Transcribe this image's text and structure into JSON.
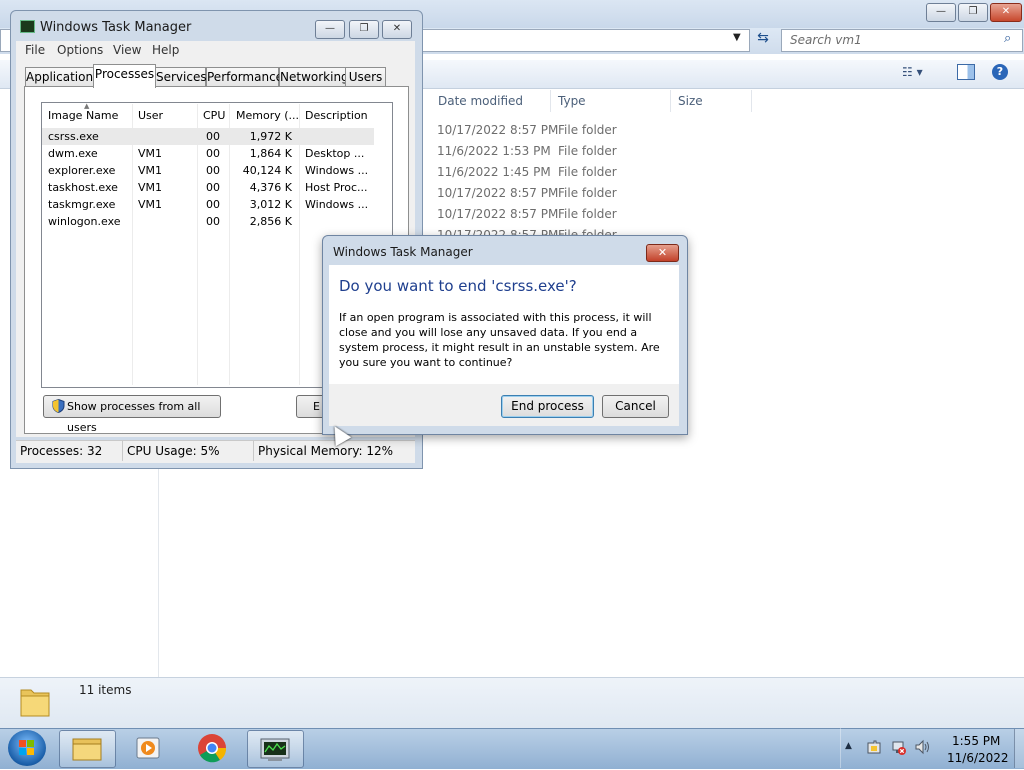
{
  "explorer": {
    "search_placeholder": "Search vm1",
    "columns": [
      "Date modified",
      "Type",
      "Size"
    ],
    "rows": [
      {
        "date": "10/17/2022 8:57 PM",
        "type": "File folder"
      },
      {
        "date": "11/6/2022 1:53 PM",
        "type": "File folder"
      },
      {
        "date": "11/6/2022 1:45 PM",
        "type": "File folder"
      },
      {
        "date": "10/17/2022 8:57 PM",
        "type": "File folder"
      },
      {
        "date": "10/17/2022 8:57 PM",
        "type": "File folder"
      },
      {
        "date": "10/17/2022 8:57 PM",
        "type": "File folder"
      }
    ],
    "status_count": "11 items"
  },
  "task_manager": {
    "title": "Windows Task Manager",
    "menu": [
      "File",
      "Options",
      "View",
      "Help"
    ],
    "tabs": [
      "Applications",
      "Processes",
      "Services",
      "Performance",
      "Networking",
      "Users"
    ],
    "columns": [
      "Image Name",
      "User Name",
      "CPU",
      "Memory (...",
      "Description"
    ],
    "processes": [
      {
        "name": "csrss.exe",
        "user": "",
        "cpu": "00",
        "mem": "1,972 K",
        "desc": ""
      },
      {
        "name": "dwm.exe",
        "user": "VM1",
        "cpu": "00",
        "mem": "1,864 K",
        "desc": "Desktop ..."
      },
      {
        "name": "explorer.exe",
        "user": "VM1",
        "cpu": "00",
        "mem": "40,124 K",
        "desc": "Windows ..."
      },
      {
        "name": "taskhost.exe",
        "user": "VM1",
        "cpu": "00",
        "mem": "4,376 K",
        "desc": "Host Proc..."
      },
      {
        "name": "taskmgr.exe",
        "user": "VM1",
        "cpu": "00",
        "mem": "3,012 K",
        "desc": "Windows ..."
      },
      {
        "name": "winlogon.exe",
        "user": "",
        "cpu": "00",
        "mem": "2,856 K",
        "desc": ""
      }
    ],
    "show_all_label": "Show processes from all users",
    "end_label_partial": "E",
    "status": {
      "processes": "Processes: 32",
      "cpu": "CPU Usage: 5%",
      "memory": "Physical Memory: 12%"
    }
  },
  "dialog": {
    "title": "Windows Task Manager",
    "heading": "Do you want to end 'csrss.exe'?",
    "body": "If an open program is associated with this process, it will close and you will lose any unsaved data. If you end a system process, it might result in an unstable system. Are you sure you want to continue?",
    "end_button": "End process",
    "cancel_button": "Cancel",
    "close_glyph": "✕"
  },
  "taskbar": {
    "time": "1:55 PM",
    "date": "11/6/2022"
  },
  "glyphs": {
    "minimize": "—",
    "maximize": "❐",
    "close": "✕"
  }
}
